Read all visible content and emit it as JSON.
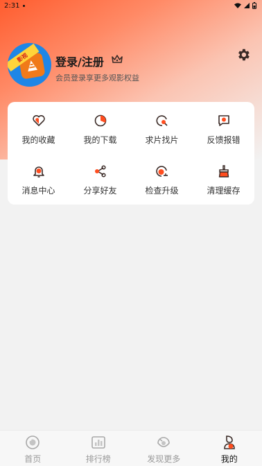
{
  "status_bar": {
    "time": "2:31"
  },
  "profile": {
    "title": "登录/注册",
    "subtitle": "会员登录享更多观影权益",
    "avatar_ribbon": "影视"
  },
  "grid": [
    {
      "label": "我的收藏",
      "icon": "heart-icon"
    },
    {
      "label": "我的下载",
      "icon": "download-icon"
    },
    {
      "label": "求片找片",
      "icon": "film-search-icon"
    },
    {
      "label": "反馈报错",
      "icon": "feedback-icon"
    },
    {
      "label": "消息中心",
      "icon": "bell-icon"
    },
    {
      "label": "分享好友",
      "icon": "share-icon"
    },
    {
      "label": "检查升级",
      "icon": "upgrade-icon"
    },
    {
      "label": "清理缓存",
      "icon": "broom-icon"
    }
  ],
  "nav": [
    {
      "label": "首页",
      "icon": "home-icon"
    },
    {
      "label": "排行榜",
      "icon": "ranking-icon"
    },
    {
      "label": "发现更多",
      "icon": "discover-icon"
    },
    {
      "label": "我的",
      "icon": "profile-icon",
      "active": true
    }
  ],
  "colors": {
    "accent": "#ff4d1f",
    "brand_gradient_start": "#ff5c2e",
    "dark_icon": "#3a2a26"
  }
}
